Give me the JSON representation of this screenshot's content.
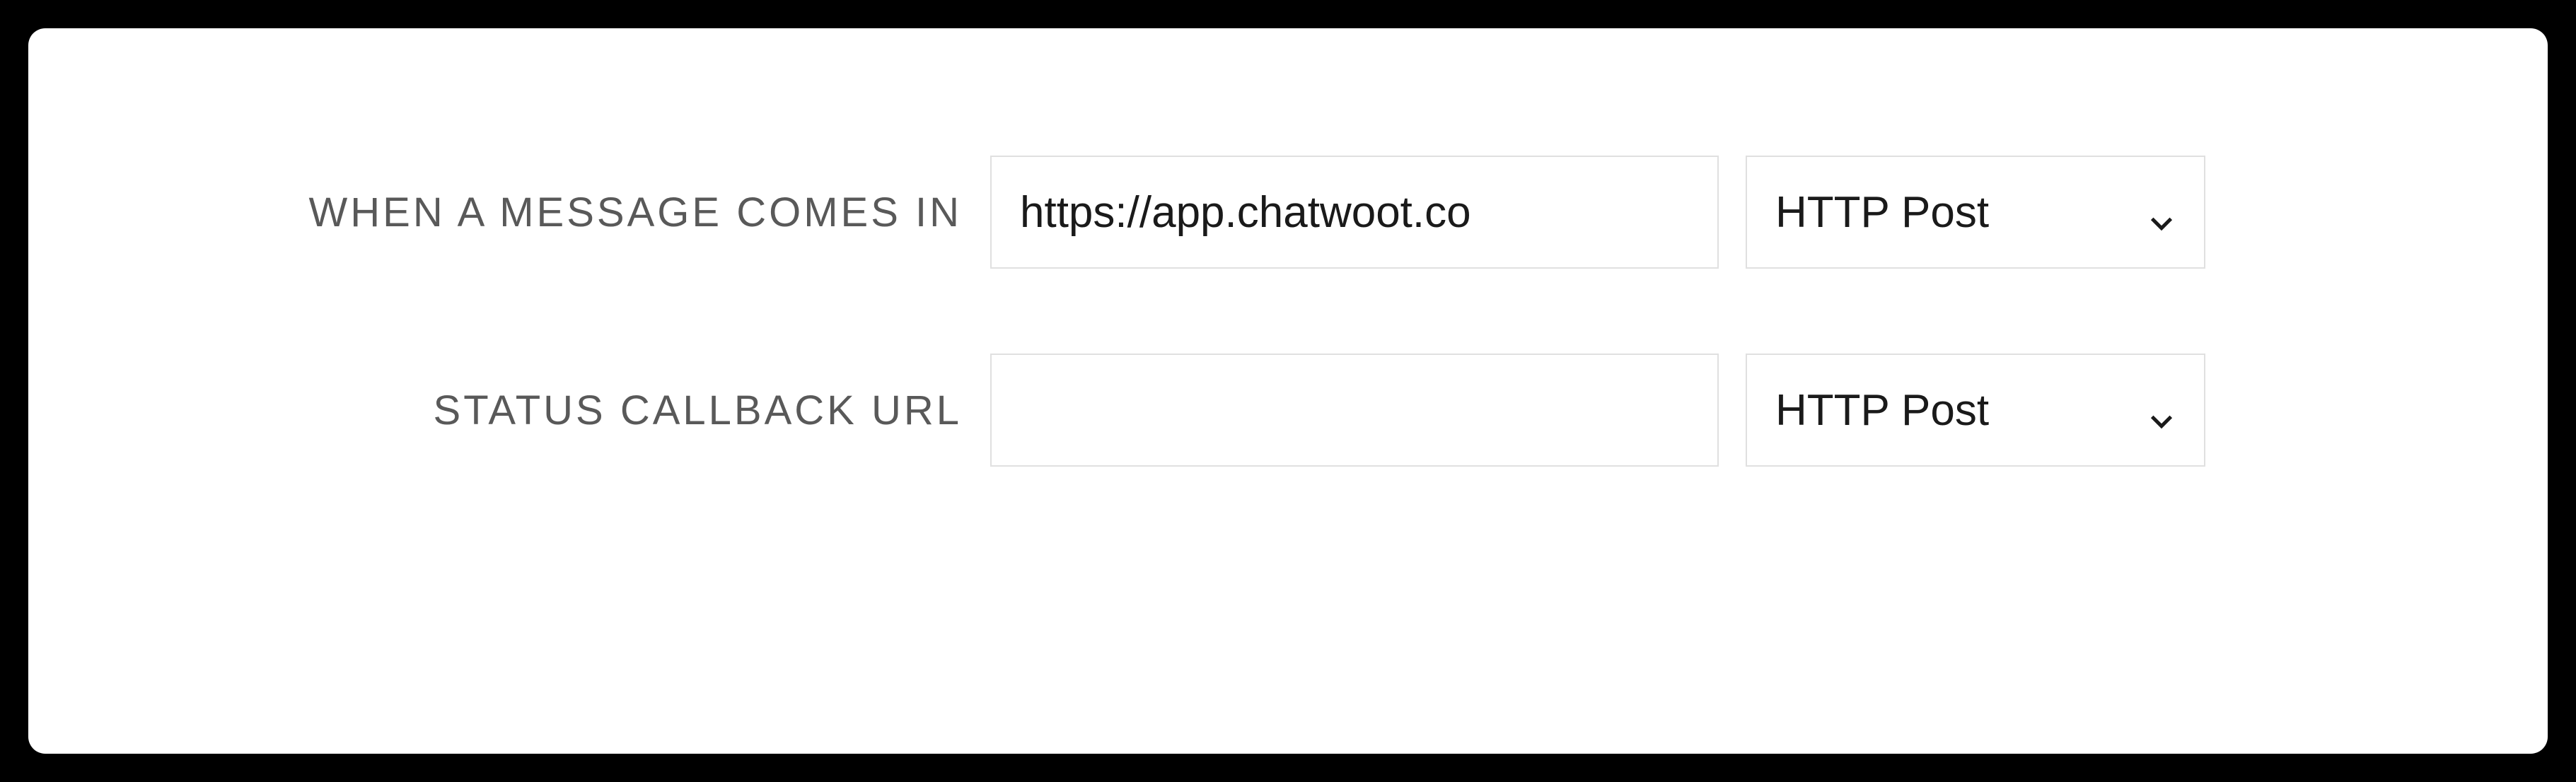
{
  "form": {
    "rows": [
      {
        "label": "WHEN A MESSAGE COMES IN",
        "url_value": "https://app.chatwoot.co",
        "method": "HTTP Post"
      },
      {
        "label": "STATUS CALLBACK URL",
        "url_value": "",
        "method": "HTTP Post"
      }
    ]
  }
}
